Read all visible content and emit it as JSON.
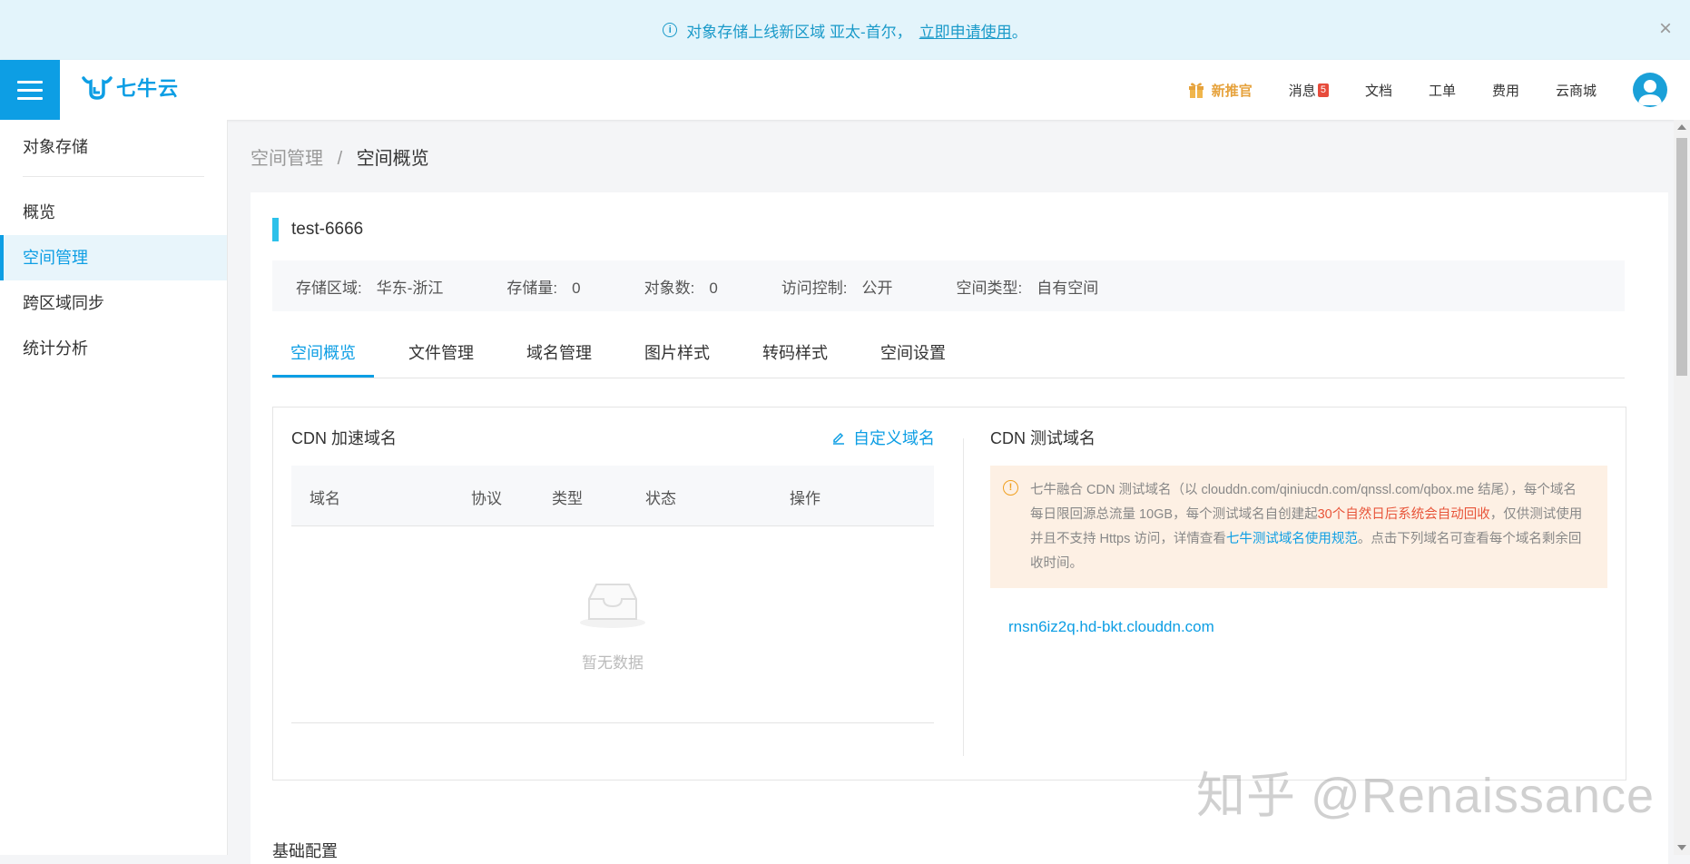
{
  "banner": {
    "text": "对象存储上线新区域 亚太-首尔，",
    "link": "立即申请使用",
    "suffix": "。",
    "close": "×"
  },
  "header": {
    "logo_text": "七牛云",
    "nav": {
      "new_promo": "新推官",
      "messages": "消息",
      "message_count": "5",
      "docs": "文档",
      "tickets": "工单",
      "billing": "费用",
      "marketplace": "云商城"
    }
  },
  "sidebar": {
    "title": "对象存储",
    "items": [
      {
        "label": "概览"
      },
      {
        "label": "空间管理"
      },
      {
        "label": "跨区域同步"
      },
      {
        "label": "统计分析"
      }
    ]
  },
  "breadcrumb": {
    "parent": "空间管理",
    "separator": "/",
    "current": "空间概览"
  },
  "bucket": {
    "name": "test-6666",
    "info": {
      "region_label": "存储区域:",
      "region_value": "华东-浙江",
      "storage_label": "存储量:",
      "storage_value": "0",
      "objects_label": "对象数:",
      "objects_value": "0",
      "access_label": "访问控制:",
      "access_value": "公开",
      "type_label": "空间类型:",
      "type_value": "自有空间"
    }
  },
  "tabs": [
    {
      "label": "空间概览"
    },
    {
      "label": "文件管理"
    },
    {
      "label": "域名管理"
    },
    {
      "label": "图片样式"
    },
    {
      "label": "转码样式"
    },
    {
      "label": "空间设置"
    }
  ],
  "cdn": {
    "title": "CDN 加速域名",
    "custom_domain": "自定义域名",
    "columns": [
      "域名",
      "协议",
      "类型",
      "状态",
      "操作"
    ],
    "empty_text": "暂无数据"
  },
  "test_domain": {
    "title": "CDN 测试域名",
    "notice_part1": "七牛融合 CDN 测试域名（以 clouddn.com/qiniucdn.com/qnssl.com/qbox.me 结尾），每个域名每日限回源总流量 10GB，每个测试域名自创建起",
    "notice_red": "30个自然日后系统会自动回收",
    "notice_part2": "，仅供测试使用并且不支持 Https 访问，详情查看",
    "notice_link": "七牛测试域名使用规范",
    "notice_part3": "。点击下列域名可查看每个域名剩余回收时间。",
    "domain": "rnsn6iz2q.hd-bkt.clouddn.com"
  },
  "basic_config_title": "基础配置",
  "watermark": "知乎 @Renaissance",
  "colors": {
    "accent": "#0d9ee4",
    "banner_bg": "#e3f4fb",
    "notice_bg": "#fdf0e4",
    "notice_red": "#e8553a",
    "promo": "#e6a23c"
  }
}
